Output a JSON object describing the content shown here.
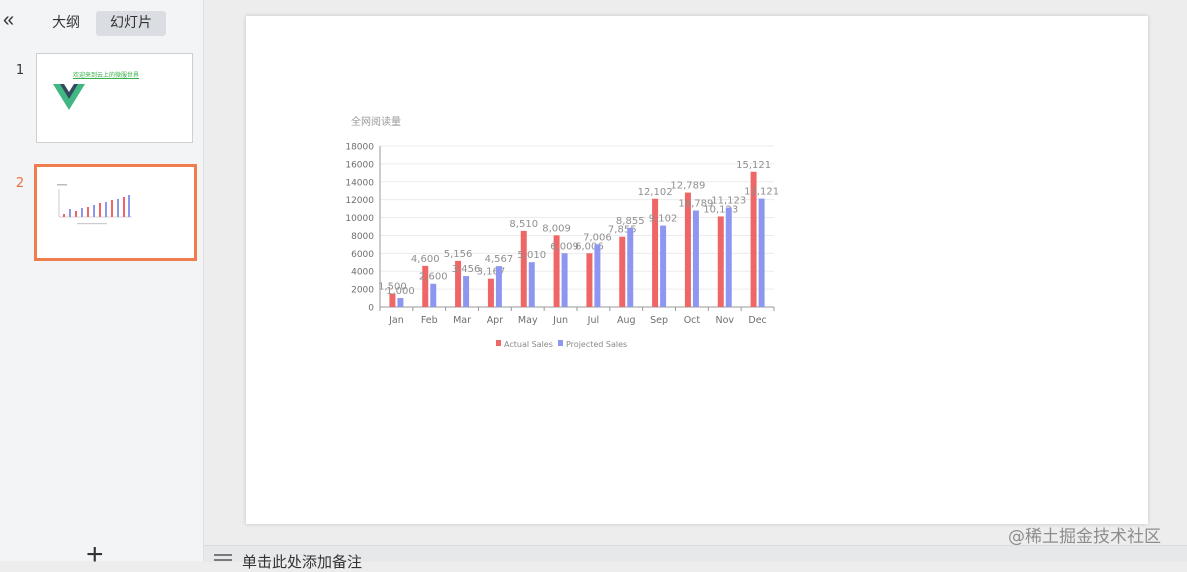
{
  "sidebar": {
    "collapse_glyph": "«",
    "tabs": [
      {
        "label": "大纲",
        "active": false
      },
      {
        "label": "幻灯片",
        "active": true
      }
    ],
    "slides": [
      {
        "number": "1",
        "thumb_text": "欢迎来到云上的微服世界"
      },
      {
        "number": "2"
      }
    ],
    "add_glyph": "+"
  },
  "notes": {
    "placeholder": "单击此处添加备注"
  },
  "watermark": "@稀土掘金技术社区",
  "colors": {
    "actual": "#ee6666",
    "projected": "#8e97f0",
    "accent": "#ef7d4e"
  },
  "chart_data": {
    "type": "bar",
    "title": "全网阅读量",
    "categories": [
      "Jan",
      "Feb",
      "Mar",
      "Apr",
      "May",
      "Jun",
      "Jul",
      "Aug",
      "Sep",
      "Oct",
      "Nov",
      "Dec"
    ],
    "series": [
      {
        "name": "Actual Sales",
        "values": [
          1500,
          4600,
          5156,
          3167,
          8510,
          8009,
          6006,
          7855,
          12102,
          12789,
          10123,
          15121
        ]
      },
      {
        "name": "Projected Sales",
        "values": [
          1000,
          2600,
          3456,
          4567,
          5010,
          6009,
          7006,
          8855,
          9102,
          10789,
          11123,
          12121
        ]
      }
    ],
    "data_labels": {
      "Actual Sales": [
        "1,500",
        "4,600",
        "5,156",
        "3,167",
        "8,510",
        "8,009",
        "6,006",
        "7,855",
        "12,102",
        "12,789",
        "10,123",
        "15,121"
      ],
      "Projected Sales": [
        "1,000",
        "2,600",
        "3,456",
        "4,567",
        "5,010",
        "6,009",
        "7,006",
        "8,855",
        "9,102",
        "10,789",
        "11,123",
        "12,121"
      ]
    },
    "ylim": [
      0,
      18000
    ],
    "yticks": [
      0,
      2000,
      4000,
      6000,
      8000,
      10000,
      12000,
      14000,
      16000,
      18000
    ],
    "grid": true,
    "legend": "bottom-center"
  }
}
